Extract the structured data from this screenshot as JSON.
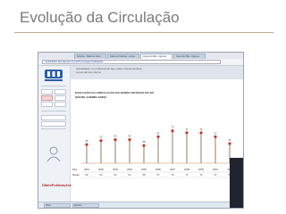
{
  "slide": {
    "title": "Evolução da Circulação"
  },
  "browser": {
    "tabs": [
      "Notícias · Diário de Notíc…",
      "Diário de Notícias - Jornal…",
      "Grupo do Mãe - Agência",
      "Grupo dn Mãe - Agêncie"
    ],
    "address": "mediadados.dgs dgruppo.com/pt/homepage/mediadados"
  },
  "main": {
    "description": [
      "Actualidade, os profissionais que cuida a fiesta da área",
      "comercial dos sítulos"
    ],
    "chart_title": "EVOLUÇÃO DA CIRCULAÇÃO DO DIÁRIO NOTÍCIAS DO NÚ",
    "chart_subtitle": "(EM MIL EXEMPLARES)"
  },
  "chart_data": {
    "type": "scatter",
    "categories": [
      "2001",
      "2002",
      "2003",
      "2004",
      "2005",
      "2006",
      "2007",
      "2008",
      "2009",
      "2010",
      "2011"
    ],
    "values": [
      59,
      63,
      64,
      64,
      58,
      67,
      73,
      71,
      71,
      67,
      60
    ],
    "row_labels": [
      "Mês",
      "Média"
    ],
    "colors": {
      "marker": "#c0392b",
      "stem": "#7a5b3a",
      "line": "#d0b090"
    }
  },
  "footer": {
    "brand": "DiárioPublicações"
  },
  "taskbar": [
    "Word",
    "Explorer"
  ]
}
